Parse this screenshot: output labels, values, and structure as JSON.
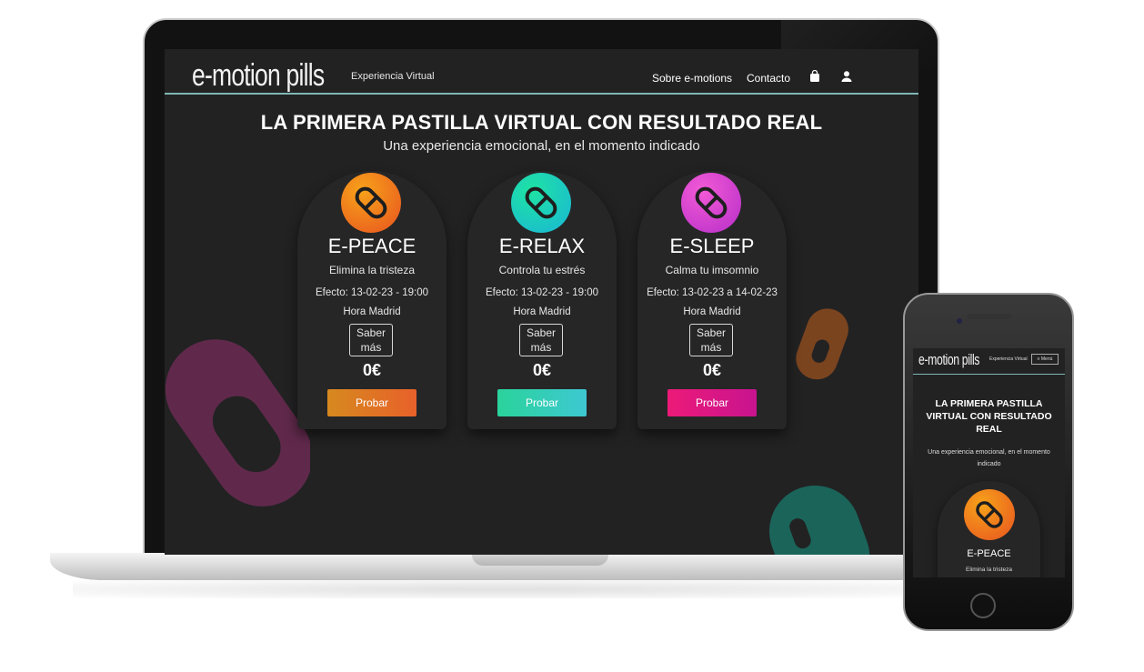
{
  "site": {
    "logo": "e-motion pills",
    "logo_sub": "Experiencia Virtual",
    "nav": [
      "Sobre e-motions",
      "Contacto"
    ],
    "icons": [
      "shopping-bag-icon",
      "user-icon"
    ]
  },
  "hero": {
    "title": "LA PRIMERA PASTILLA VIRTUAL CON RESULTADO REAL",
    "subtitle": "Una experiencia emocional, en el momento indicado"
  },
  "cards": [
    {
      "name": "E-PEACE",
      "desc": "Elimina la tristeza",
      "effect": "Efecto: 13-02-23 - 19:00",
      "zone": "Hora Madrid",
      "more": "Saber más",
      "price": "0€",
      "cta": "Probar",
      "gradient": [
        "#f7a21a",
        "#e8531f"
      ],
      "button": [
        "#d6891f",
        "#e8612a"
      ]
    },
    {
      "name": "E-RELAX",
      "desc": "Controla tu estrés",
      "effect": "Efecto: 13-02-23 - 19:00",
      "zone": "Hora Madrid",
      "more": "Saber más",
      "price": "0€",
      "cta": "Probar",
      "gradient": [
        "#1fe3a3",
        "#19b6d6"
      ],
      "button": [
        "#2ad39b",
        "#3ec8d2"
      ]
    },
    {
      "name": "E-SLEEP",
      "desc": "Calma tu imsomnio",
      "effect": "Efecto: 13-02-23 a 14-02-23",
      "zone": "Hora Madrid",
      "more": "Saber más",
      "price": "0€",
      "cta": "Probar",
      "gradient": [
        "#f25ad6",
        "#b62ec8"
      ],
      "button": [
        "#ec1a78",
        "#c8148f"
      ]
    }
  ],
  "mobile": {
    "logo": "e-motion pills",
    "logo_sub": "Experiencia Virtual",
    "menu": "≡ Menú",
    "title": "LA PRIMERA PASTILLA VIRTUAL CON RESULTADO REAL",
    "subtitle": "Una experiencia emocional, en el momento indicado",
    "card_name": "E-PEACE",
    "card_desc": "Elimina la tristeza"
  }
}
